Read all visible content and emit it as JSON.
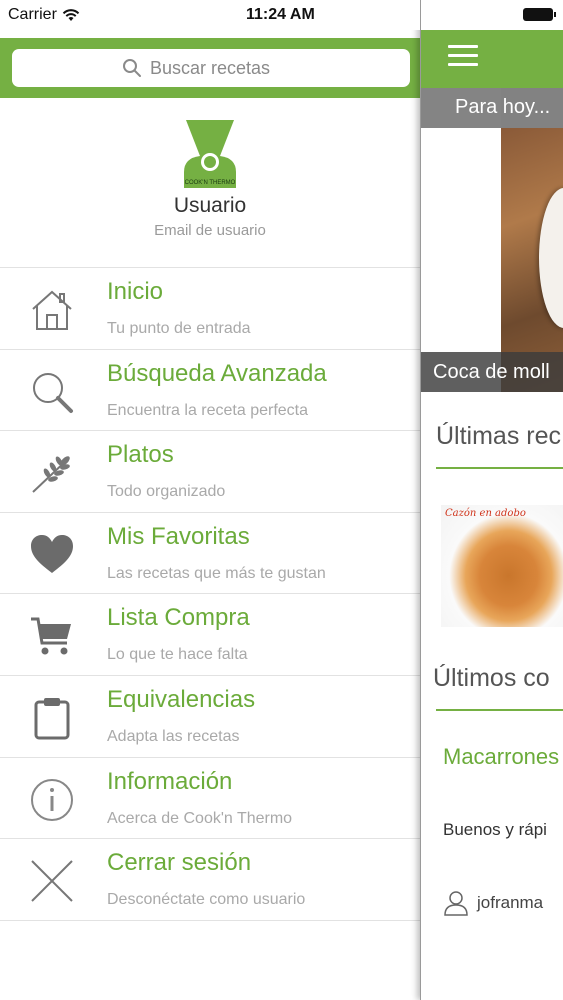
{
  "status_bar": {
    "carrier": "Carrier",
    "time": "11:24 AM"
  },
  "search": {
    "placeholder": "Buscar recetas"
  },
  "profile": {
    "name": "Usuario",
    "email": "Email de usuario",
    "logo_text": "COOK'N THERMO"
  },
  "menu": [
    {
      "icon": "home-icon",
      "title": "Inicio",
      "subtitle": "Tu punto de entrada"
    },
    {
      "icon": "magnifier-icon",
      "title": "Búsqueda Avanzada",
      "subtitle": "Encuentra la receta perfecta"
    },
    {
      "icon": "wheat-icon",
      "title": "Platos",
      "subtitle": "Todo organizado"
    },
    {
      "icon": "heart-icon",
      "title": "Mis Favoritas",
      "subtitle": "Las recetas que más te gustan"
    },
    {
      "icon": "cart-icon",
      "title": "Lista Compra",
      "subtitle": "Lo que te hace falta"
    },
    {
      "icon": "clipboard-icon",
      "title": "Equivalencias",
      "subtitle": "Adapta las recetas"
    },
    {
      "icon": "info-icon",
      "title": "Información",
      "subtitle": "Acerca de Cook'n Thermo"
    },
    {
      "icon": "close-icon",
      "title": "Cerrar sesión",
      "subtitle": "Desconéctate como usuario"
    }
  ],
  "content": {
    "today_label": "Para hoy...",
    "hero_caption": "Coca de moll",
    "latest_recipes_title": "Últimas rec",
    "recipe_image_label": "Cazón en adobo",
    "latest_comments_title": "Últimos co",
    "comment_recipe": "Macarrones",
    "comment_text": "Buenos y rápi",
    "comment_author": "jofranma"
  },
  "colors": {
    "brand_green": "#75b043",
    "menu_title_green": "#6bab3a"
  }
}
